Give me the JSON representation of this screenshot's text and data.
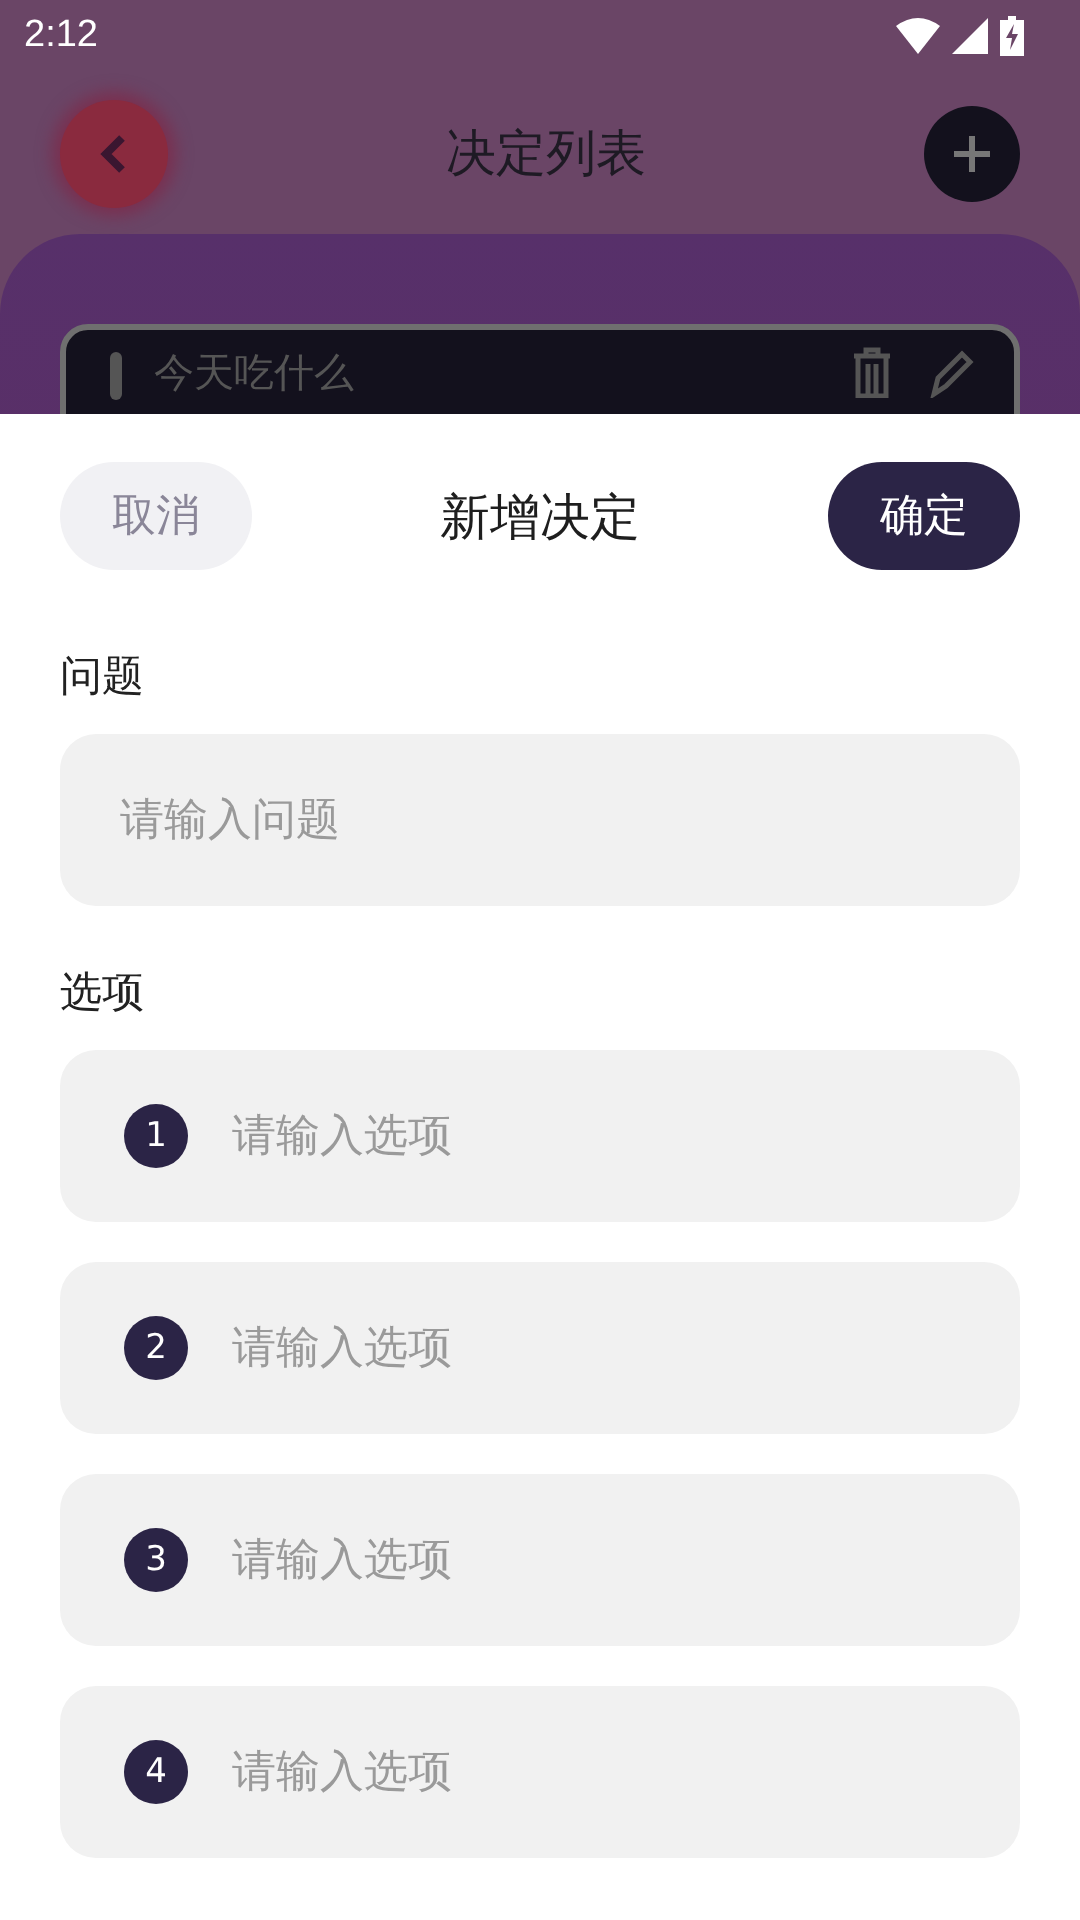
{
  "status_bar": {
    "time": "2:12"
  },
  "header": {
    "title": "决定列表"
  },
  "list": {
    "items": [
      {
        "title": "今天吃什么"
      }
    ]
  },
  "sheet": {
    "cancel": "取消",
    "title": "新增决定",
    "confirm": "确定",
    "question_label": "问题",
    "question": {
      "placeholder": "请输入问题"
    },
    "options_label": "选项",
    "options": [
      {
        "number": "1",
        "placeholder": "请输入选项"
      },
      {
        "number": "2",
        "placeholder": "请输入选项"
      },
      {
        "number": "3",
        "placeholder": "请输入选项"
      },
      {
        "number": "4",
        "placeholder": "请输入选项"
      }
    ]
  }
}
